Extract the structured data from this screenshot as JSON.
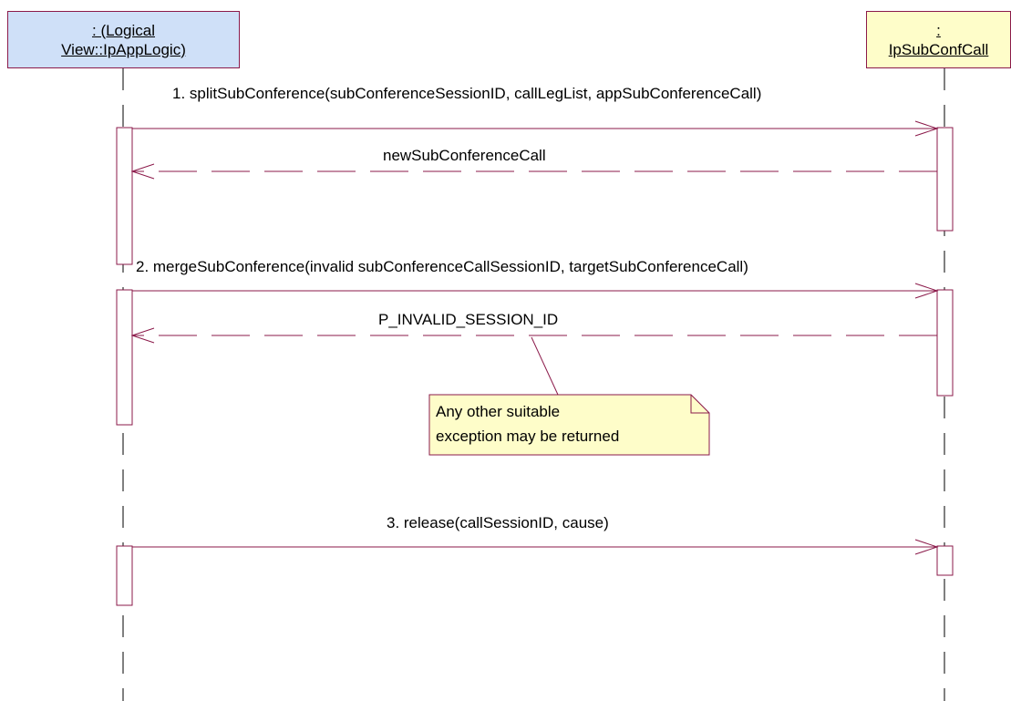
{
  "objects": {
    "left": {
      "line1": ": (Logical",
      "line2": "View::IpAppLogic)"
    },
    "right": {
      "line1": ":",
      "line2": "IpSubConfCall"
    }
  },
  "messages": [
    {
      "label": "1. splitSubConference(subConferenceSessionID, callLegList, appSubConferenceCall)",
      "kind": "call"
    },
    {
      "label": "newSubConferenceCall",
      "kind": "return"
    },
    {
      "label": "2. mergeSubConference(invalid subConferenceCallSessionID, targetSubConferenceCall)",
      "kind": "call"
    },
    {
      "label": "P_INVALID_SESSION_ID",
      "kind": "return"
    },
    {
      "label": "3. release(callSessionID, cause)",
      "kind": "call"
    }
  ],
  "note": {
    "line1": "Any other suitable",
    "line2": "exception may be returned"
  },
  "colors": {
    "line": "#8b1a4a",
    "lifeline": "#000000",
    "left_header_fill": "#cfe0f8",
    "right_header_fill": "#fefdc9",
    "note_fill": "#fefdc9"
  }
}
